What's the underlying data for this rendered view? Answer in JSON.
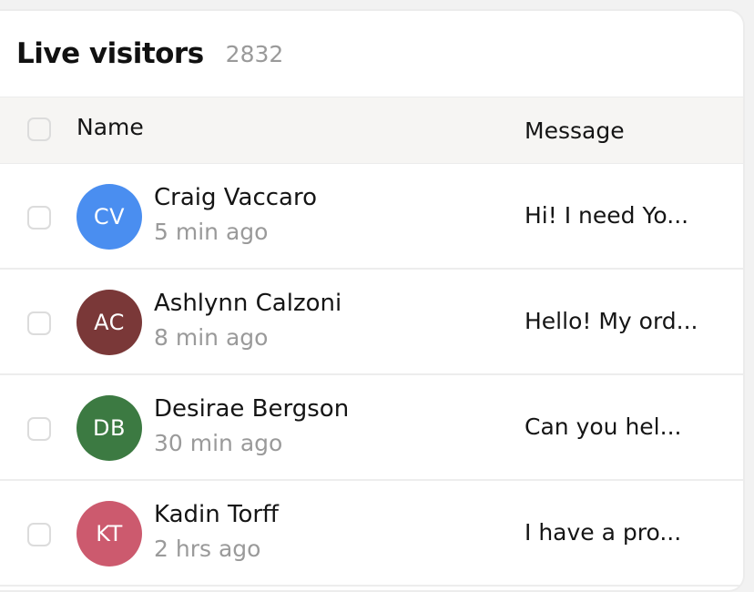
{
  "header": {
    "title": "Live visitors",
    "count": "2832"
  },
  "table": {
    "columns": {
      "name": "Name",
      "message": "Message"
    },
    "rows": [
      {
        "initials": "CV",
        "avatar_color": "#4a8ef0",
        "name": "Craig Vaccaro",
        "time": "5 min ago",
        "message": "Hi! I need Yo..."
      },
      {
        "initials": "AC",
        "avatar_color": "#7a3838",
        "name": "Ashlynn Calzoni",
        "time": "8 min ago",
        "message": "Hello! My ord..."
      },
      {
        "initials": "DB",
        "avatar_color": "#3c7a42",
        "name": "Desirae Bergson",
        "time": "30 min ago",
        "message": "Can you hel..."
      },
      {
        "initials": "KT",
        "avatar_color": "#cc5a6e",
        "name": "Kadin Torff",
        "time": "2 hrs ago",
        "message": "I have a pro..."
      }
    ]
  }
}
